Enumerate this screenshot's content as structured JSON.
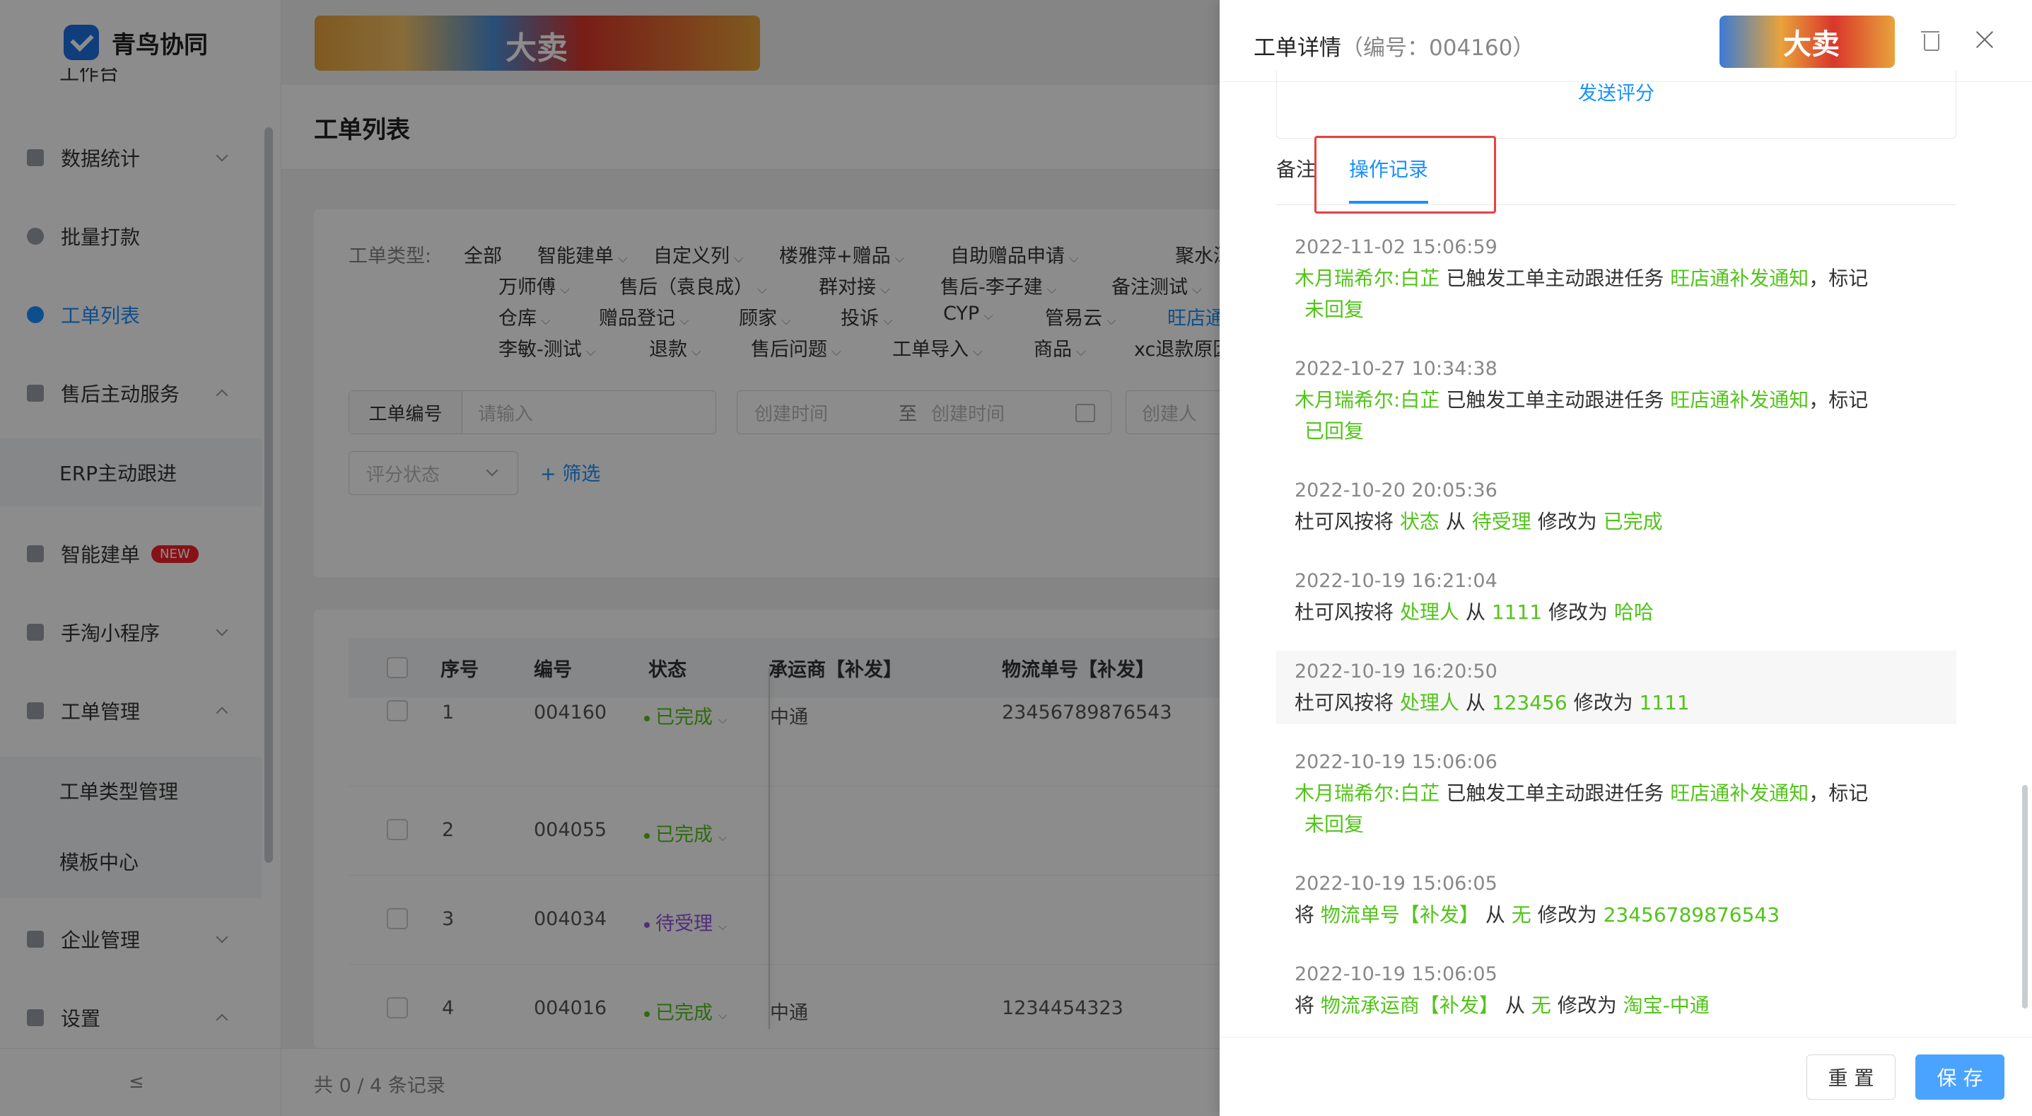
{
  "sidebar": {
    "brand": "青鸟协同",
    "partial_item": "工作台",
    "items": [
      {
        "label": "数据统计",
        "icon": "bar-chart-icon"
      },
      {
        "label": "批量打款",
        "icon": "payment-icon"
      },
      {
        "label": "工单列表",
        "icon": "search-icon",
        "active": true
      },
      {
        "label": "售后主动服务",
        "icon": "service-icon"
      },
      {
        "label": "ERP主动跟进"
      },
      {
        "label": "智能建单",
        "icon": "smart-order-icon",
        "badge": "NEW"
      },
      {
        "label": "手淘小程序",
        "icon": "miniapp-icon"
      },
      {
        "label": "工单管理",
        "icon": "ticket-manage-icon"
      },
      {
        "label": "工单类型管理"
      },
      {
        "label": "模板中心"
      },
      {
        "label": "企业管理",
        "icon": "company-icon"
      },
      {
        "label": "设置",
        "icon": "settings-icon"
      }
    ],
    "collapse_label": "≤"
  },
  "main": {
    "title": "工单列表",
    "banner_text": "大卖",
    "filter": {
      "type_label": "工单类型:",
      "tags": [
        "全部",
        "智能建单",
        "自定义列",
        "楼雅萍+赠品",
        "自助赠品申请",
        "聚水潭",
        "万师傅",
        "售后（袁良成）",
        "群对接",
        "售后-李子建",
        "备注测试",
        "仓库",
        "赠品登记",
        "顾家",
        "投诉",
        "CYP",
        "管易云",
        "旺店通",
        "李敏-测试",
        "退款",
        "售后问题",
        "工单导入",
        "商品",
        "xc退款原因"
      ],
      "order_no_label": "工单编号",
      "order_no_placeholder": "请输入",
      "date_start_placeholder": "创建时间",
      "date_sep": "至",
      "date_end_placeholder": "创建时间",
      "creator_placeholder": "创建人",
      "rating_placeholder": "评分状态",
      "filter_link": "+ 筛选"
    },
    "table": {
      "headers": [
        "序号",
        "编号",
        "状态",
        "承运商【补发】",
        "物流单号【补发】"
      ],
      "rows": [
        {
          "index": "1",
          "no": "004160",
          "status": "已完成",
          "carrier": "中通",
          "tracking": "23456789876543"
        },
        {
          "index": "2",
          "no": "004055",
          "status": "已完成",
          "carrier": "",
          "tracking": ""
        },
        {
          "index": "3",
          "no": "004034",
          "status": "待受理",
          "carrier": "",
          "tracking": ""
        },
        {
          "index": "4",
          "no": "004016",
          "status": "已完成",
          "carrier": "中通",
          "tracking": "1234454323"
        }
      ]
    },
    "footer_count": "共 0 / 4 条记录"
  },
  "drawer": {
    "title": "工单详情",
    "title_sub": "（编号：004160）",
    "banner_text": "大卖",
    "send_rating": "发送评分",
    "tabs": [
      "备注",
      "操作记录"
    ],
    "active_tab": "操作记录",
    "logs": [
      {
        "time": "2022-11-02 15:06:59",
        "who": "木月瑞希尔:白芷",
        "a": "已触发工单主动跟进任务",
        "task": "旺店通补发通知",
        "b": "，标记",
        "mark": "未回复"
      },
      {
        "time": "2022-10-27 10:34:38",
        "who": "木月瑞希尔:白芷",
        "a": "已触发工单主动跟进任务",
        "task": "旺店通补发通知",
        "b": "，标记",
        "mark": "已回复"
      },
      {
        "time": "2022-10-20 20:05:36",
        "who": "杜可风按将",
        "field": "状态",
        "from_word": "从",
        "from": "待受理",
        "to_word": "修改为",
        "to": "已完成"
      },
      {
        "time": "2022-10-19 16:21:04",
        "who": "杜可风按将",
        "field": "处理人",
        "from_word": "从",
        "from": "1111",
        "to_word": "修改为",
        "to": "哈哈"
      },
      {
        "time": "2022-10-19 16:20:50",
        "who": "杜可风按将",
        "field": "处理人",
        "from_word": "从",
        "from": "123456",
        "to_word": "修改为",
        "to": "1111"
      },
      {
        "time": "2022-10-19 15:06:06",
        "who": "木月瑞希尔:白芷",
        "a": "已触发工单主动跟进任务",
        "task": "旺店通补发通知",
        "b": "，标记",
        "mark": "未回复"
      },
      {
        "time": "2022-10-19 15:06:05",
        "who": "将",
        "field": "物流单号【补发】",
        "from_word": "从",
        "from": "无",
        "to_word": "修改为",
        "to": "23456789876543"
      },
      {
        "time": "2022-10-19 15:06:05",
        "who": "将",
        "field": "物流承运商【补发】",
        "from_word": "从",
        "from": "无",
        "to_word": "修改为",
        "to": "淘宝-中通"
      }
    ],
    "reset_label": "重 置",
    "save_label": "保 存"
  },
  "colors": {
    "primary": "#1890ff",
    "success": "#52c41a",
    "pending": "#9254de",
    "highlight": "#e64340"
  }
}
